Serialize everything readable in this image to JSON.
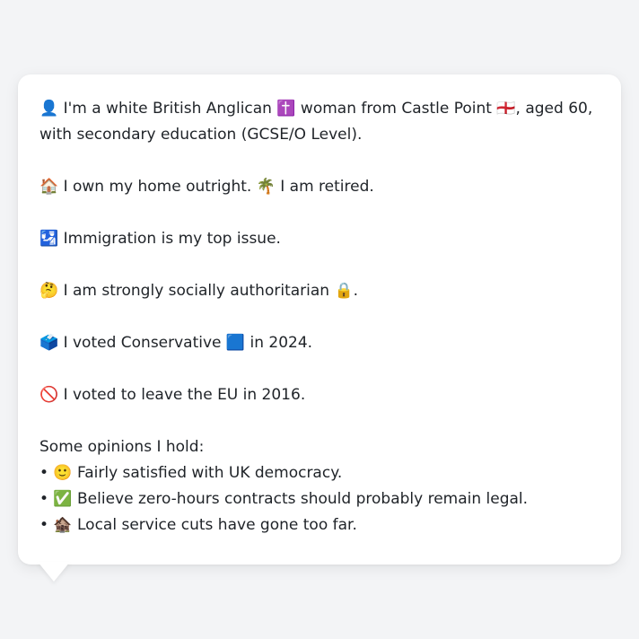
{
  "persona": {
    "intro": "👤 I'm a white British Anglican ✝️ woman from Castle Point 🏴󠁧󠁢󠁥󠁮󠁧󠁿, aged 60, with secondary education (GCSE/O Level).",
    "home": "🏠 I own my home outright. 🌴 I am retired.",
    "issue": "🛂 Immigration is my top issue.",
    "social": "🤔 I am strongly socially authoritarian 🔒.",
    "vote2024": "🗳️ I voted Conservative 🟦 in 2024.",
    "eu": "🚫 I voted to leave the EU in 2016.",
    "opinions_heading": "Some opinions I hold:",
    "opinions": [
      "• 🙂 Fairly satisfied with UK democracy.",
      "• ✅ Believe zero-hours contracts should probably remain legal.",
      "• 🏚️ Local service cuts have gone too far."
    ]
  }
}
